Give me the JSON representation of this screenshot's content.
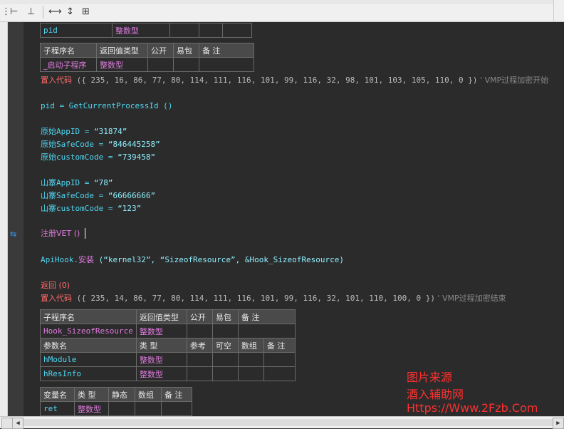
{
  "toolbar": {
    "icons": [
      "align-icon",
      "fit-width-icon",
      "fit-height-icon",
      "cut-icon",
      "copy-icon",
      "paste-icon",
      "horizontal-resize-icon",
      "vertical-resize-icon",
      "grid-icon"
    ],
    "glyphs": [
      "⋮",
      "⊢",
      "⊥",
      "▭",
      "▭",
      "▭",
      "⟷",
      "↕",
      "⊞"
    ]
  },
  "var_table_top": {
    "row": [
      "pid",
      "整数型",
      "",
      "",
      ""
    ]
  },
  "sub1": {
    "header": [
      "子程序名",
      "返回值类型",
      "公开",
      "易包",
      "备 注"
    ],
    "row": [
      "_启动子程序",
      "整数型",
      "",
      "",
      ""
    ]
  },
  "code": {
    "line1": {
      "kw": "置入代码",
      "args": " ({ 235, 16, 86, 77, 80, 114, 111, 116, 101, 99, 116, 32, 98, 101, 103, 105, 110, 0 })",
      "comment": "  ' VMP过程加密开始"
    },
    "line2": "pid = GetCurrentProcessId ()",
    "line3": {
      "name": "原始AppID",
      "eq": " = ",
      "val": "“31874”"
    },
    "line4": {
      "name": "原始SafeCode",
      "eq": " = ",
      "val": "“846445258”"
    },
    "line5": {
      "name": "原始customCode",
      "eq": " = ",
      "val": "“739458”"
    },
    "line6": {
      "name": "山寨AppID",
      "eq": " = ",
      "val": "“78”"
    },
    "line7": {
      "name": "山寨SafeCode",
      "eq": " = ",
      "val": "“66666666”"
    },
    "line8": {
      "name": "山寨customCode",
      "eq": " = ",
      "val": "“123”"
    },
    "line9": "注册VET ()",
    "line10": {
      "a": "ApiHook.",
      "b": "安装",
      "c": " (“kernel32”, “SizeofResource”, &Hook_SizeofResource)"
    },
    "line11": "返回 (0)",
    "line12": {
      "kw": "置入代码",
      "args": " ({ 235, 14, 86, 77, 80, 114, 111, 116, 101, 99, 116, 32, 101, 110, 100, 0 })",
      "comment": "  ' VMP过程加密结束"
    }
  },
  "sub2": {
    "header": [
      "子程序名",
      "返回值类型",
      "公开",
      "易包",
      "备 注"
    ],
    "row": [
      "Hook_SizeofResource",
      "整数型",
      "",
      "",
      ""
    ],
    "param_header": [
      "参数名",
      "类 型",
      "参考",
      "可空",
      "数组",
      "备 注"
    ],
    "params": [
      [
        "hModule",
        "整数型",
        "",
        "",
        "",
        ""
      ],
      [
        "hResInfo",
        "整数型",
        "",
        "",
        "",
        ""
      ]
    ]
  },
  "var_table_bottom": {
    "header": [
      "变量名",
      "类 型",
      "静态",
      "数组",
      "备 注"
    ],
    "row": [
      "ret",
      "整数型",
      "",
      "",
      ""
    ]
  },
  "watermark": {
    "line1": "图片来源",
    "line2": "酒入辅助网",
    "line3": "Https://Www.2Fzb.Com"
  },
  "scroll": {
    "left": "◀",
    "right": "▶"
  }
}
